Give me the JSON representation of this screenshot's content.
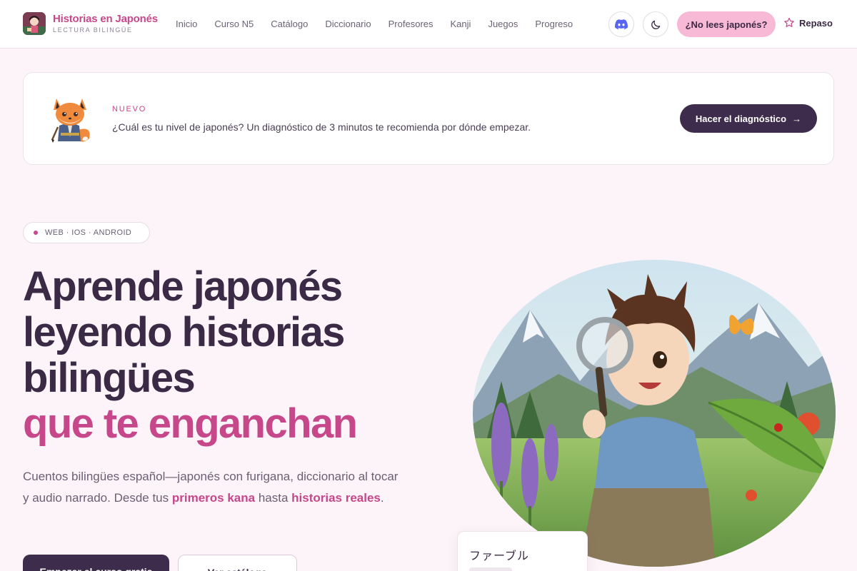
{
  "brand": {
    "title": "Historias en Japonés",
    "subtitle": "LECTURA BILINGÜE"
  },
  "nav": {
    "items": [
      "Inicio",
      "Curso N5",
      "Catálogo",
      "Diccionario",
      "Profesores",
      "Kanji",
      "Juegos",
      "Progreso"
    ]
  },
  "header": {
    "discord_icon": "discord-icon",
    "theme_icon": "moon-icon",
    "no_japanese_label": "¿No lees japonés?",
    "repaso_label": "Repaso"
  },
  "banner": {
    "tag": "NUEVO",
    "text": "¿Cuál es tu nivel de japonés? Un diagnóstico de 3 minutos te recomienda por dónde empezar.",
    "button_label": "Hacer el diagnóstico",
    "button_arrow": "→"
  },
  "hero": {
    "platforms": "WEB · IOS · ANDROID",
    "title_line1": "Aprende japonés",
    "title_line2": "leyendo historias",
    "title_line3": "bilingües",
    "title_accent": "que te enganchan",
    "desc_part1": "Cuentos bilingües español—japonés con furigana, diccionario al tocar y audio narrado. Desde tus ",
    "desc_bold1": "primeros kana",
    "desc_part2": " hasta ",
    "desc_bold2": "historias reales",
    "desc_part3": ".",
    "primary_button": "Empezar el curso gratis",
    "secondary_button": "Ver catálogo"
  },
  "card": {
    "word": "ファーブル"
  },
  "colors": {
    "accent": "#c6478a",
    "dark": "#3d2c4b",
    "pink_button": "#f8b9d6",
    "background": "#fcf4f8"
  }
}
